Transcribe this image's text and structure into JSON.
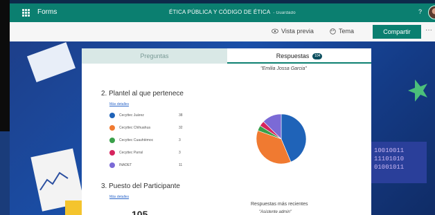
{
  "topbar": {
    "app_name": "Forms",
    "title": "ÉTICA PÚBLICA Y CÓDIGO DE ÉTICA",
    "saved": "- Guardado",
    "help": "?"
  },
  "commands": {
    "preview": "Vista previa",
    "theme": "Tema",
    "share": "Compartir",
    "more": "···"
  },
  "tabs": {
    "questions": "Preguntas",
    "responses": "Respuestas",
    "response_count": "104"
  },
  "latest_quote": "\"Emilia Jossa Garcia\"",
  "question2": {
    "title": "2. Plantel al que pertenece",
    "details_link": "Más detalles",
    "options": [
      {
        "label": "Cecyttec Juárez",
        "count": "38",
        "color": "#1f63b8"
      },
      {
        "label": "Cecyttec Chihuahua",
        "count": "32",
        "color": "#f07a31"
      },
      {
        "label": "Cecyttec Cuauhtémoc",
        "count": "3",
        "color": "#3aa04a"
      },
      {
        "label": "Cecyttec Parral",
        "count": "3",
        "color": "#d6245e"
      },
      {
        "label": "INADET",
        "count": "11",
        "color": "#7b6ad6"
      }
    ]
  },
  "question3": {
    "title": "3. Puesto del Participante",
    "details_link": "Más detalles",
    "total": "105"
  },
  "recent": {
    "label": "Respuestas más recientes",
    "quote": "\"Asistente admin\""
  },
  "chart_data": {
    "type": "pie",
    "categories": [
      "Cecyttec Juárez",
      "Cecyttec Chihuahua",
      "Cecyttec Cuauhtémoc",
      "Cecyttec Parral",
      "INADET"
    ],
    "values": [
      38,
      32,
      3,
      3,
      11
    ],
    "colors": [
      "#1f63b8",
      "#f07a31",
      "#3aa04a",
      "#d6245e",
      "#7b6ad6"
    ]
  }
}
